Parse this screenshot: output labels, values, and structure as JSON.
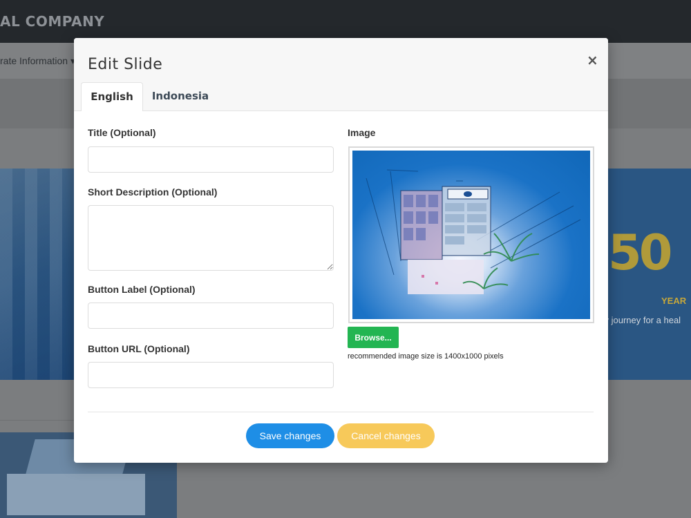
{
  "background": {
    "brand": "AL COMPANY",
    "nav_item": "rate Information ▾",
    "banner_number": "50",
    "banner_years": "YEAR",
    "banner_caption": "ity journey for a heal"
  },
  "modal": {
    "title": "Edit Slide",
    "close_symbol": "×",
    "tabs": [
      {
        "label": "English",
        "active": true
      },
      {
        "label": "Indonesia",
        "active": false
      }
    ],
    "fields": {
      "title_label": "Title (Optional)",
      "title_value": "",
      "short_desc_label": "Short Description (Optional)",
      "short_desc_value": "",
      "button_label_label": "Button Label (Optional)",
      "button_label_value": "",
      "button_url_label": "Button URL (Optional)",
      "button_url_value": ""
    },
    "image": {
      "label": "Image",
      "browse_label": "Browse...",
      "note": "recommended image size is 1400x1000 pixels"
    },
    "save_label": "Save changes",
    "cancel_label": "Cancel changes"
  },
  "colors": {
    "primary": "#1e8ee6",
    "warning": "#f7c95a",
    "success": "#23b552"
  },
  "icons": {
    "close": "close-icon",
    "resize": "resize-handle-icon"
  }
}
